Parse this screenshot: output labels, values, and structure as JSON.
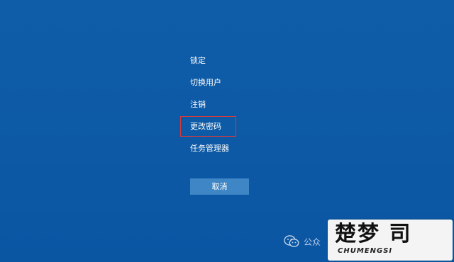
{
  "menu": {
    "items": [
      {
        "label": "锁定"
      },
      {
        "label": "切换用户"
      },
      {
        "label": "注销"
      },
      {
        "label": "更改密码",
        "highlighted": true
      },
      {
        "label": "任务管理器"
      }
    ]
  },
  "cancel_label": "取消",
  "watermark": {
    "text": "公众",
    "icon": "wechat-icon"
  },
  "brand": {
    "mark": "楚梦 司",
    "subtitle": "CHUMENGSI"
  },
  "colors": {
    "background": "#0d5aa8",
    "button": "#3f86c6",
    "highlight": "#d83a3a",
    "text": "#ffffff"
  }
}
